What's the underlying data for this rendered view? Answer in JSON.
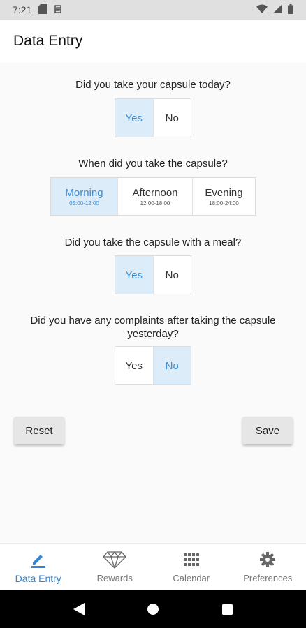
{
  "status_bar": {
    "time": "7:21"
  },
  "app_bar": {
    "title": "Data Entry"
  },
  "questions": {
    "q1": {
      "text": "Did you take your capsule today?",
      "options": [
        "Yes",
        "No"
      ],
      "selected": "Yes"
    },
    "q2": {
      "text": "When did you take the capsule?",
      "options": [
        {
          "label": "Morning",
          "range": "05:00-12:00"
        },
        {
          "label": "Afternoon",
          "range": "12:00-18:00"
        },
        {
          "label": "Evening",
          "range": "18:00-24:00"
        }
      ],
      "selected": "Morning"
    },
    "q3": {
      "text": "Did you take the capsule with a meal?",
      "options": [
        "Yes",
        "No"
      ],
      "selected": "Yes"
    },
    "q4": {
      "text": "Did you have any complaints after taking the capsule yesterday?",
      "options": [
        "Yes",
        "No"
      ],
      "selected": "No"
    }
  },
  "actions": {
    "reset": "Reset",
    "save": "Save"
  },
  "bottom_nav": {
    "items": [
      {
        "label": "Data Entry",
        "icon": "pencil-icon",
        "active": true
      },
      {
        "label": "Rewards",
        "icon": "diamond-icon",
        "active": false
      },
      {
        "label": "Calendar",
        "icon": "grid-icon",
        "active": false
      },
      {
        "label": "Preferences",
        "icon": "gear-icon",
        "active": false
      }
    ]
  },
  "colors": {
    "accent": "#2f86d6",
    "selected_bg": "#dcecf8"
  }
}
